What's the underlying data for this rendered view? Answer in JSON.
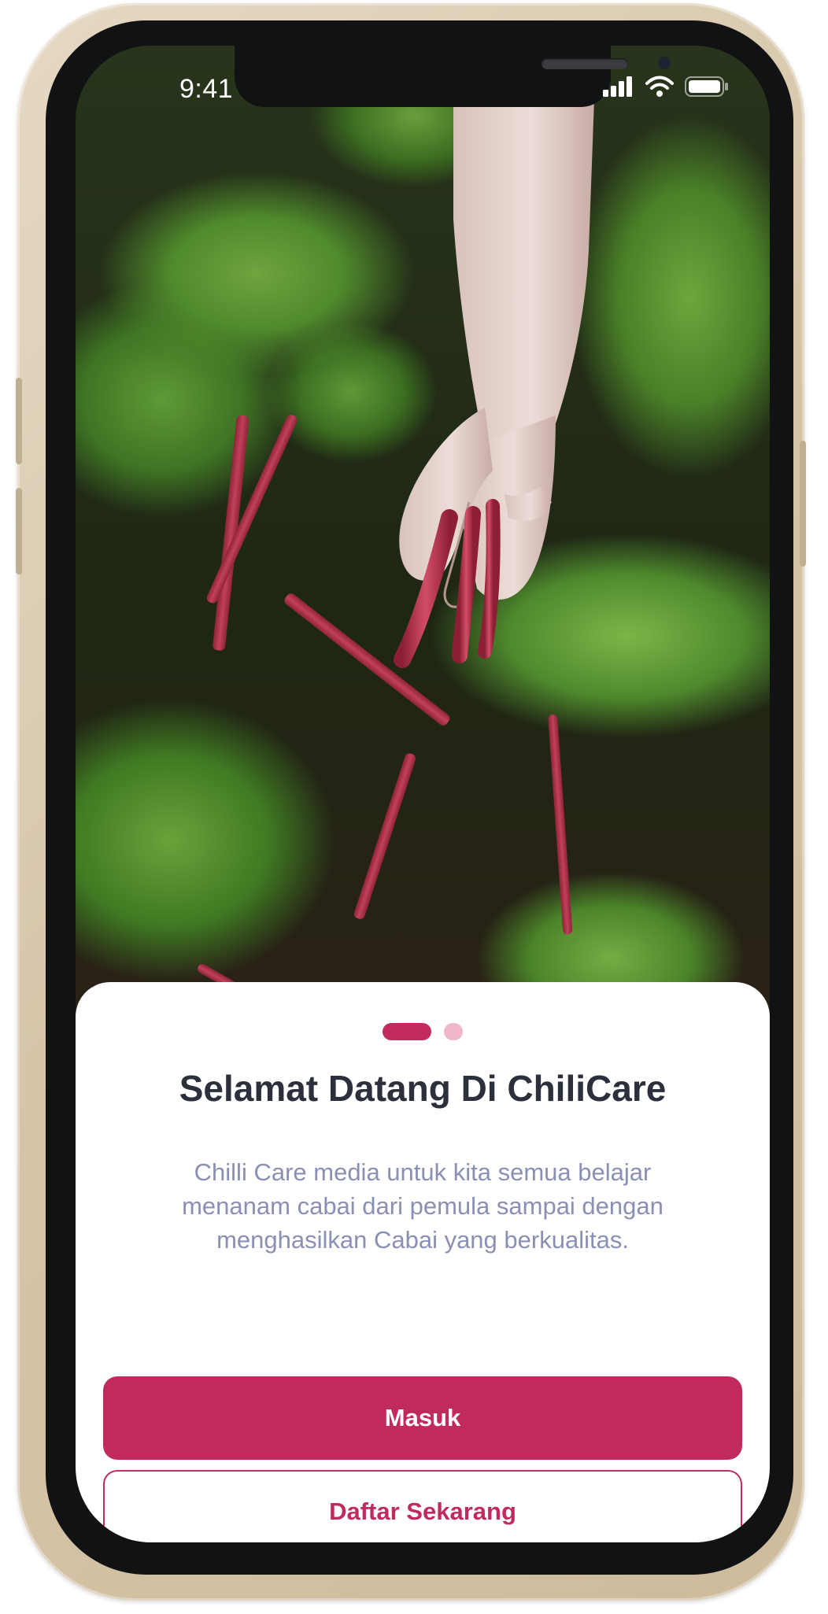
{
  "status_bar": {
    "time": "9:41"
  },
  "onboarding": {
    "title": "Selamat Datang Di ChiliCare",
    "description": "Chilli Care media untuk kita semua belajar menanam cabai dari pemula sampai dengan menghasilkan Cabai yang berkualitas.",
    "page_indicator": {
      "total_pages": 2,
      "active_page": 1
    }
  },
  "actions": {
    "login_label": "Masuk",
    "register_label": "Daftar Sekarang"
  },
  "icons": {
    "signal": "cellular-signal-icon",
    "wifi": "wifi-icon",
    "battery": "battery-icon"
  },
  "colors": {
    "primary": "#c12a5e",
    "indicator_inactive": "#efb6cc",
    "title": "#2c2f3c",
    "body_text": "#8a8fb4",
    "phone_case": "#d6c5a9"
  }
}
